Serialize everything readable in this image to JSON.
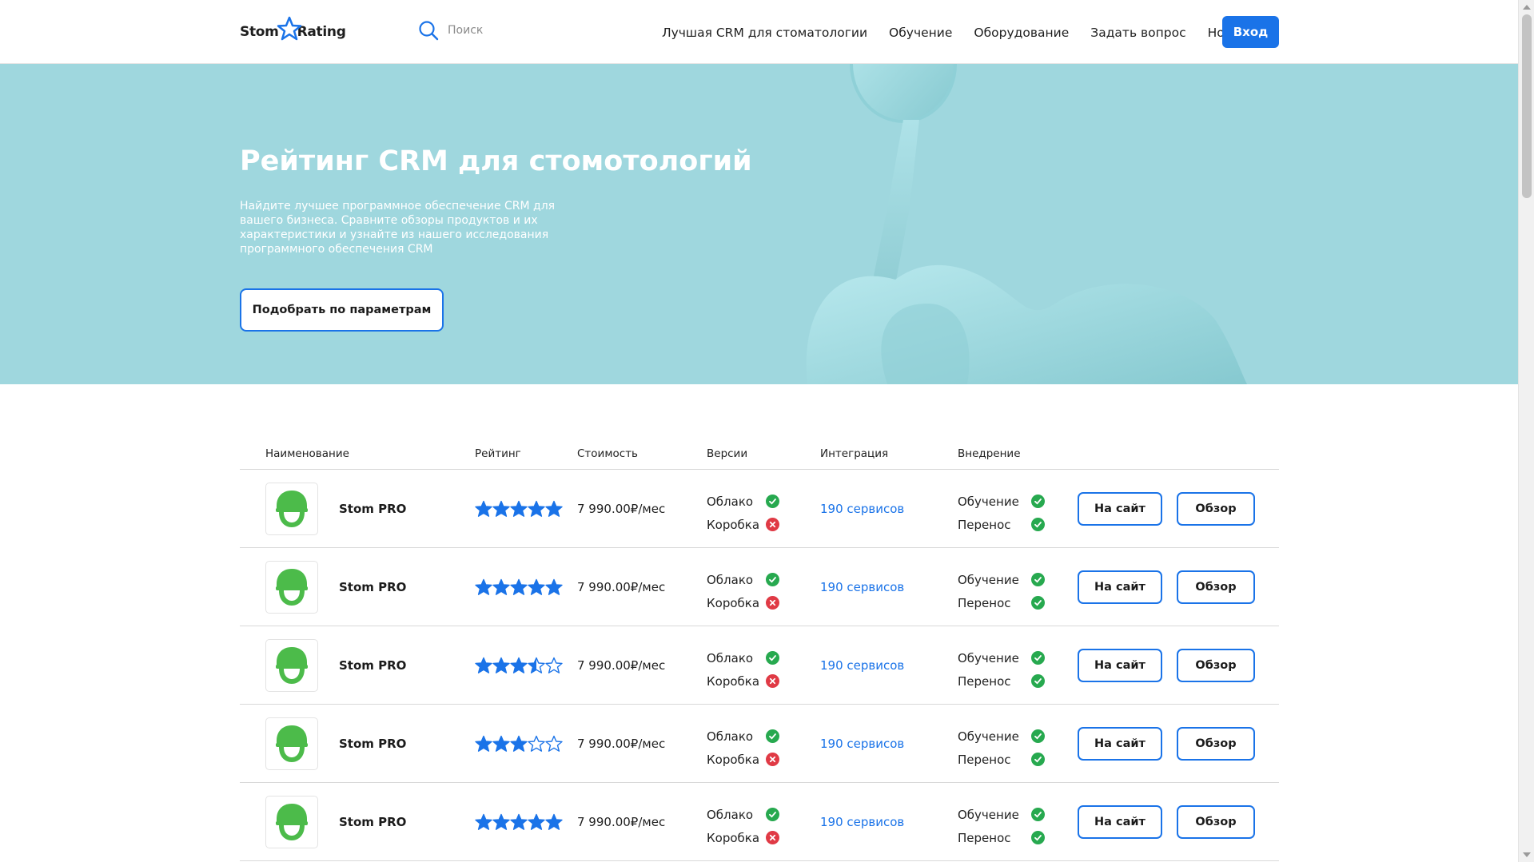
{
  "header": {
    "logo_left": "Stom",
    "logo_right": "Rating",
    "search_placeholder": "Поиск",
    "nav": [
      {
        "label": "Лучшая CRM для стоматологии"
      },
      {
        "label": "Обучение"
      },
      {
        "label": "Оборудование"
      },
      {
        "label": "Задать вопрос"
      },
      {
        "label": "Новости"
      }
    ],
    "login_label": "Вход"
  },
  "hero": {
    "title": "Рейтинг CRM для стомотологий",
    "description": "Найдите лучшее программное обеспечение CRM для вашего бизнеса. Сравните обзоры продуктов и их характеристики и узнайте из нашего исследования программного обеспечения CRM",
    "button_label": "Подобрать по параметрам"
  },
  "table": {
    "headers": {
      "name": "Наименование",
      "rating": "Рейтинг",
      "price": "Стоимость",
      "versions": "Версии",
      "integration": "Интеграция",
      "implementation": "Внедрение"
    },
    "rows": [
      {
        "name": "Stom PRO",
        "rating": 5,
        "price": "7 990.00₽/мес",
        "cloud_label": "Облако",
        "cloud": true,
        "box_label": "Коробка",
        "box": false,
        "integration": "190 сервисов",
        "training_label": "Обучение",
        "training": true,
        "transfer_label": "Перенос",
        "transfer": true,
        "site_label": "На сайт",
        "review_label": "Обзор"
      },
      {
        "name": "Stom PRO",
        "rating": 5,
        "price": "7 990.00₽/мес",
        "cloud_label": "Облако",
        "cloud": true,
        "box_label": "Коробка",
        "box": false,
        "integration": "190 сервисов",
        "training_label": "Обучение",
        "training": true,
        "transfer_label": "Перенос",
        "transfer": true,
        "site_label": "На сайт",
        "review_label": "Обзор"
      },
      {
        "name": "Stom PRO",
        "rating": 3.5,
        "price": "7 990.00₽/мес",
        "cloud_label": "Облако",
        "cloud": true,
        "box_label": "Коробка",
        "box": false,
        "integration": "190 сервисов",
        "training_label": "Обучение",
        "training": true,
        "transfer_label": "Перенос",
        "transfer": true,
        "site_label": "На сайт",
        "review_label": "Обзор"
      },
      {
        "name": "Stom PRO",
        "rating": 3,
        "price": "7 990.00₽/мес",
        "cloud_label": "Облако",
        "cloud": true,
        "box_label": "Коробка",
        "box": false,
        "integration": "190 сервисов",
        "training_label": "Обучение",
        "training": true,
        "transfer_label": "Перенос",
        "transfer": true,
        "site_label": "На сайт",
        "review_label": "Обзор"
      },
      {
        "name": "Stom PRO",
        "rating": 5,
        "price": "7 990.00₽/мес",
        "cloud_label": "Облако",
        "cloud": true,
        "box_label": "Коробка",
        "box": false,
        "integration": "190 сервисов",
        "training_label": "Обучение",
        "training": true,
        "transfer_label": "Перенос",
        "transfer": true,
        "site_label": "На сайт",
        "review_label": "Обзор"
      }
    ]
  },
  "colors": {
    "accent": "#1a73e8",
    "hero_bg": "#9fd7de",
    "ok": "#27a94f",
    "no": "#e03a45",
    "avatar_green": "#4cbb4a"
  },
  "icons": [
    "star-logo-icon",
    "search-icon",
    "helmet-avatar-icon",
    "star-icon",
    "check-icon",
    "cross-icon"
  ]
}
